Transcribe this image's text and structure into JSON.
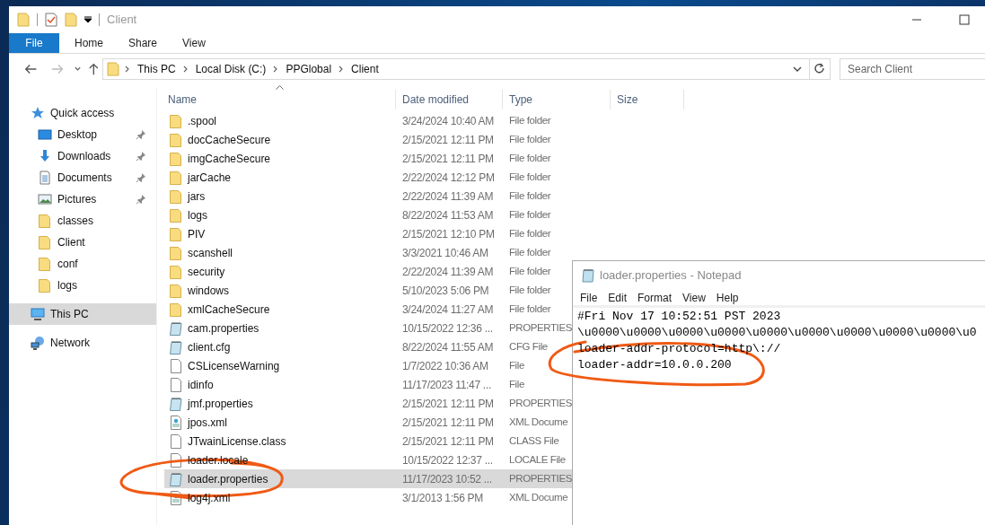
{
  "explorer": {
    "title": "Client",
    "ribbon_tabs": [
      {
        "label": "File",
        "kind": "file"
      },
      {
        "label": "Home",
        "kind": "tab"
      },
      {
        "label": "Share",
        "kind": "tab"
      },
      {
        "label": "View",
        "kind": "tab"
      }
    ],
    "nav_buttons": [
      {
        "kind": "back",
        "disabled": false
      },
      {
        "kind": "forward",
        "disabled": true
      },
      {
        "kind": "recent",
        "disabled": false
      },
      {
        "kind": "up",
        "disabled": false
      }
    ],
    "breadcrumbs": [
      "This PC",
      "Local Disk (C:)",
      "PPGlobal",
      "Client"
    ],
    "search": {
      "placeholder": "Search Client"
    },
    "sidebar": {
      "items": [
        {
          "label": "Quick access",
          "kind": "star",
          "selected": false,
          "children": [
            {
              "label": "Desktop",
              "kind": "desktop",
              "pinned": true,
              "selected": false
            },
            {
              "label": "Downloads",
              "kind": "download",
              "pinned": true,
              "selected": false
            },
            {
              "label": "Documents",
              "kind": "documents",
              "pinned": true,
              "selected": false
            },
            {
              "label": "Pictures",
              "kind": "pictures",
              "pinned": true,
              "selected": false
            },
            {
              "label": "classes",
              "kind": "folder",
              "pinned": false,
              "selected": false
            },
            {
              "label": "Client",
              "kind": "folder",
              "pinned": false,
              "selected": false
            },
            {
              "label": "conf",
              "kind": "folder",
              "pinned": false,
              "selected": false
            },
            {
              "label": "logs",
              "kind": "folder",
              "pinned": false,
              "selected": false
            }
          ]
        },
        {
          "label": "This PC",
          "kind": "pc",
          "selected": true
        },
        {
          "label": "Network",
          "kind": "network",
          "selected": false
        }
      ]
    },
    "columns": [
      "Name",
      "Date modified",
      "Type",
      "Size"
    ],
    "files": [
      {
        "name": ".spool",
        "date": "3/24/2024 10:40 AM",
        "type": "File folder",
        "kind": "folder",
        "selected": false
      },
      {
        "name": "docCacheSecure",
        "date": "2/15/2021 12:11 PM",
        "type": "File folder",
        "kind": "folder",
        "selected": false
      },
      {
        "name": "imgCacheSecure",
        "date": "2/15/2021 12:11 PM",
        "type": "File folder",
        "kind": "folder",
        "selected": false
      },
      {
        "name": "jarCache",
        "date": "2/22/2024 12:12 PM",
        "type": "File folder",
        "kind": "folder",
        "selected": false
      },
      {
        "name": "jars",
        "date": "2/22/2024 11:39 AM",
        "type": "File folder",
        "kind": "folder",
        "selected": false
      },
      {
        "name": "logs",
        "date": "8/22/2024 11:53 AM",
        "type": "File folder",
        "kind": "folder",
        "selected": false
      },
      {
        "name": "PIV",
        "date": "2/15/2021 12:10 PM",
        "type": "File folder",
        "kind": "folder",
        "selected": false
      },
      {
        "name": "scanshell",
        "date": "3/3/2021 10:46 AM",
        "type": "File folder",
        "kind": "folder",
        "selected": false
      },
      {
        "name": "security",
        "date": "2/22/2024 11:39 AM",
        "type": "File folder",
        "kind": "folder",
        "selected": false
      },
      {
        "name": "windows",
        "date": "5/10/2023 5:06 PM",
        "type": "File folder",
        "kind": "folder",
        "selected": false
      },
      {
        "name": "xmlCacheSecure",
        "date": "3/24/2024 11:27 AM",
        "type": "File folder",
        "kind": "folder",
        "selected": false
      },
      {
        "name": "cam.properties",
        "date": "10/15/2022 12:36 ...",
        "type": "PROPERTIES",
        "kind": "notepad",
        "selected": false
      },
      {
        "name": "client.cfg",
        "date": "8/22/2024 11:55 AM",
        "type": "CFG File",
        "kind": "notepad",
        "selected": false
      },
      {
        "name": "CSLicenseWarning",
        "date": "1/7/2022 10:36 AM",
        "type": "File",
        "kind": "blank",
        "selected": false
      },
      {
        "name": "idinfo",
        "date": "11/17/2023 11:47 ...",
        "type": "File",
        "kind": "blank",
        "selected": false
      },
      {
        "name": "jmf.properties",
        "date": "2/15/2021 12:11 PM",
        "type": "PROPERTIES",
        "kind": "notepad",
        "selected": false
      },
      {
        "name": "jpos.xml",
        "date": "2/15/2021 12:11 PM",
        "type": "XML Docume",
        "kind": "xml",
        "selected": false
      },
      {
        "name": "JTwainLicense.class",
        "date": "2/15/2021 12:11 PM",
        "type": "CLASS File",
        "kind": "blank",
        "selected": false
      },
      {
        "name": "loader.locale",
        "date": "10/15/2022 12:37 ...",
        "type": "LOCALE File",
        "kind": "blank",
        "selected": false
      },
      {
        "name": "loader.properties",
        "date": "11/17/2023 10:52 ...",
        "type": "PROPERTIES",
        "kind": "notepad",
        "selected": true
      },
      {
        "name": "log4j.xml",
        "date": "3/1/2013 1:56 PM",
        "type": "XML Docume",
        "kind": "xml",
        "selected": false
      }
    ]
  },
  "notepad": {
    "title": "loader.properties - Notepad",
    "menu": [
      "File",
      "Edit",
      "Format",
      "View",
      "Help"
    ],
    "lines": [
      "#Fri Nov 17 10:52:51 PST 2023",
      "\\u0000\\u0000\\u0000\\u0000\\u0000\\u0000\\u0000\\u0000\\u0000\\u0",
      "loader-addr-protocol=http\\://",
      "loader-addr=10.0.0.200"
    ]
  }
}
